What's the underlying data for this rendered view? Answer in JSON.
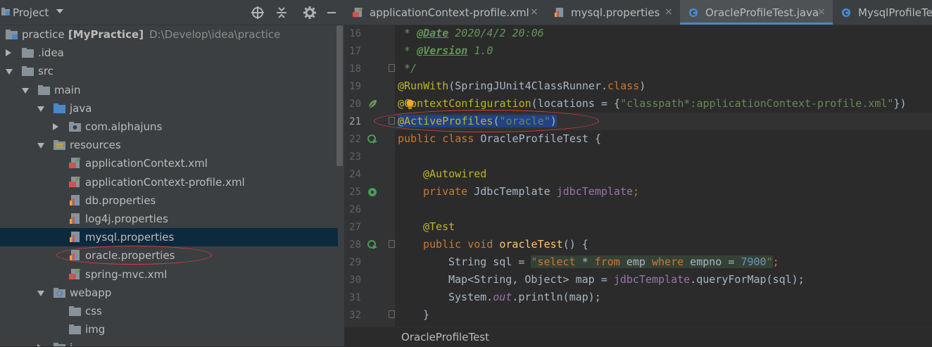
{
  "project_panel": {
    "title": "Project",
    "tools": [
      "locate-icon",
      "collapse-icon",
      "gear-icon",
      "minimize-icon"
    ],
    "tree": [
      {
        "label": "practice",
        "suffix": "[MyPractice]",
        "path": "D:\\Develop\\idea\\practice",
        "icon": "module-folder-icon",
        "arrow": "none"
      },
      {
        "label": ".idea",
        "icon": "folder-icon",
        "arrow": "right"
      },
      {
        "label": "src",
        "icon": "folder-icon",
        "arrow": "down"
      },
      {
        "label": "main",
        "icon": "folder-icon",
        "arrow": "down"
      },
      {
        "label": "java",
        "icon": "source-folder-icon",
        "arrow": "down"
      },
      {
        "label": "com.alphajuns",
        "icon": "package-icon",
        "arrow": "right"
      },
      {
        "label": "resources",
        "icon": "resources-folder-icon",
        "arrow": "down"
      },
      {
        "label": "applicationContext.xml",
        "icon": "spring-xml-icon"
      },
      {
        "label": "applicationContext-profile.xml",
        "icon": "spring-xml-icon"
      },
      {
        "label": "db.properties",
        "icon": "properties-icon"
      },
      {
        "label": "log4j.properties",
        "icon": "properties-icon"
      },
      {
        "label": "mysql.properties",
        "icon": "properties-icon",
        "selected": true
      },
      {
        "label": "oracle.properties",
        "icon": "properties-icon"
      },
      {
        "label": "spring-mvc.xml",
        "icon": "spring-xml-icon"
      },
      {
        "label": "webapp",
        "icon": "web-folder-icon",
        "arrow": "down"
      },
      {
        "label": "css",
        "icon": "folder-icon"
      },
      {
        "label": "img",
        "icon": "folder-icon"
      },
      {
        "label": "j",
        "icon": "folder-icon",
        "arrow": "right"
      }
    ]
  },
  "tabs": [
    {
      "label": "applicationContext-profile.xml",
      "icon": "spring-xml-icon",
      "active": false
    },
    {
      "label": "mysql.properties",
      "icon": "properties-icon",
      "active": false
    },
    {
      "label": "OracleProfileTest.java",
      "icon": "java-class-icon",
      "active": true
    },
    {
      "label": "MysqlProfileTest",
      "icon": "java-class-icon",
      "active": false
    }
  ],
  "close_glyph": "×",
  "editor": {
    "line_numbers": [
      "16",
      "17",
      "18",
      "19",
      "20",
      "21",
      "22",
      "23",
      "24",
      "25",
      "26",
      "27",
      "28",
      "29",
      "30",
      "31",
      "32"
    ],
    "active_line": "21",
    "code": {
      "l16_star": " * ",
      "l16_tag": "@Date",
      "l16_rest": " 2020/4/2 20:06",
      "l17_star": " * ",
      "l17_tag": "@Version",
      "l17_rest": " 1.0",
      "l18": " */",
      "l19_ann": "@RunWith",
      "l19_a": "(SpringJUnit4ClassRunner.",
      "l19_kw": "class",
      "l19_b": ")",
      "l20_ann": "@ContextConfiguration",
      "l20_a": "(locations = {",
      "l20_str": "\"classpath*:applicationContext-profile.xml\"",
      "l20_b": "})",
      "l21_ann": "@ActiveProfiles",
      "l21_a": "(",
      "l21_str": "\"oracle\"",
      "l21_b": ")",
      "l22_kw": "public class",
      "l22_rest": " OracleProfileTest {",
      "l24_ann": "@Autowired",
      "l25_kw": "private",
      "l25_type": " JdbcTemplate ",
      "l25_fld": "jdbcTemplate",
      "l25_end": ";",
      "l27_ann": "@Test",
      "l28_kw": "public void",
      "l28_fn": "oracleTest",
      "l28_rest": "() {",
      "l29_a": "String sql = ",
      "l29_q1": "\"",
      "l29_sel": "select",
      "l29_b": " * ",
      "l29_from": "from",
      "l29_c": " emp ",
      "l29_where": "where",
      "l29_d": " empno = ",
      "l29_num": "7900",
      "l29_q2": "\"",
      "l29_end": ";",
      "l30_a": "Map<String, Object> map = ",
      "l30_fld": "jdbcTemplate",
      "l30_b": ".queryForMap(sql);",
      "l31_a": "System.",
      "l31_out": "out",
      "l31_b": ".println(map);",
      "l32": "}"
    }
  },
  "breadcrumb": "OracleProfileTest",
  "colors": {
    "selection": "#214283",
    "annotation": "#bbb529",
    "keyword": "#cc7832",
    "string": "#6a8759",
    "highlight_circle": "#d83b3b"
  }
}
